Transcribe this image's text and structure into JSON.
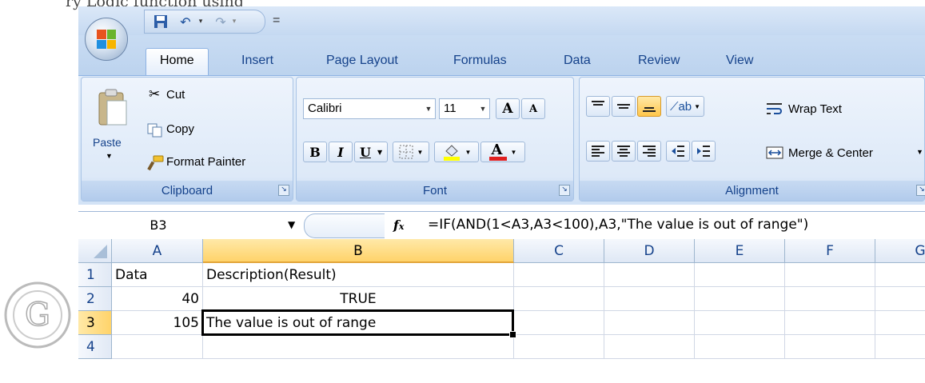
{
  "caption_fragment": "ry  Logic  function  using",
  "quick_access": {
    "save_icon": "save-icon",
    "undo_icon": "undo-icon",
    "redo_icon": "redo-icon",
    "customize_glyph": "="
  },
  "tabs": [
    "Home",
    "Insert",
    "Page Layout",
    "Formulas",
    "Data",
    "Review",
    "View"
  ],
  "active_tab": "Home",
  "clipboard": {
    "paste": "Paste",
    "cut": "Cut",
    "copy": "Copy",
    "format_painter": "Format Painter",
    "label": "Clipboard"
  },
  "font": {
    "font_name": "Calibri",
    "font_size": "11",
    "bold": "B",
    "italic": "I",
    "underline": "U",
    "grow": "A",
    "shrink": "A",
    "font_color": "A",
    "label": "Font"
  },
  "alignment": {
    "wrap_text": "Wrap Text",
    "merge_center": "Merge & Center",
    "label": "Alignment"
  },
  "formula_bar": {
    "name_box": "B3",
    "fx": "fx",
    "formula": "=IF(AND(1<A3,A3<100),A3,\"The value is out of range\")"
  },
  "sheet": {
    "columns": [
      "A",
      "B",
      "C",
      "D",
      "E",
      "F",
      "G"
    ],
    "selected_column": "B",
    "rows": [
      {
        "num": "1",
        "a": "Data",
        "b": "Description(Result)"
      },
      {
        "num": "2",
        "a": "40",
        "b": "TRUE"
      },
      {
        "num": "3",
        "a": "105",
        "b": "The value is out of range"
      },
      {
        "num": "4",
        "a": "",
        "b": ""
      }
    ],
    "selected_row": "3",
    "active_cell": "B3"
  },
  "colors": {
    "ribbon_text": "#15428b",
    "selected_header": "#ffd36a",
    "font_color_bar": "#e02020",
    "highlight_bar": "#ffff00"
  }
}
